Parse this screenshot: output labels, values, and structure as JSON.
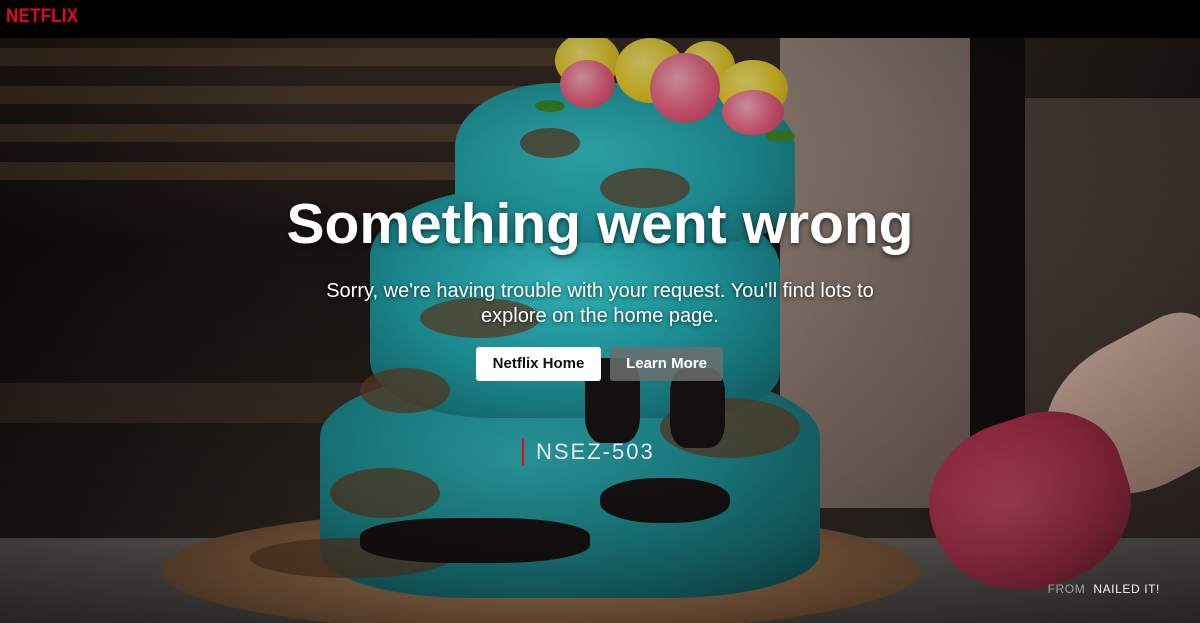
{
  "header": {
    "logo_text": "NETFLIX",
    "logo_color": "#e50914"
  },
  "error": {
    "title": "Something went wrong",
    "message": "Sorry, we're having trouble with your request. You'll find lots to explore on the home page.",
    "code": "NSEZ-503"
  },
  "buttons": {
    "home_label": "Netflix Home",
    "learn_label": "Learn More"
  },
  "credit": {
    "prefix": "FROM",
    "show": "NAILED IT!"
  },
  "background": {
    "description_icon": "cake-image"
  }
}
